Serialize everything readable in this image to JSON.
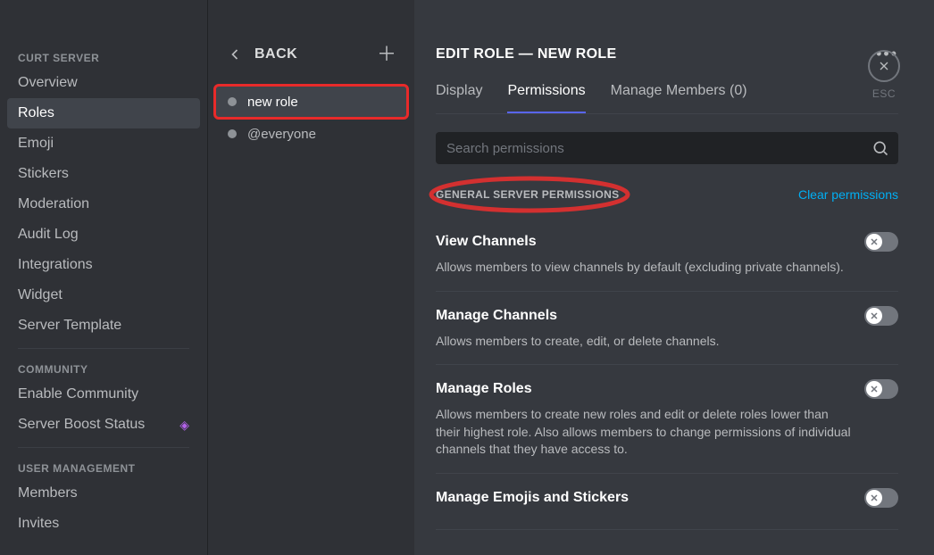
{
  "sidebar": {
    "sections": [
      {
        "heading": "CURT SERVER",
        "items": [
          {
            "label": "Overview",
            "active": false
          },
          {
            "label": "Roles",
            "active": true
          },
          {
            "label": "Emoji",
            "active": false
          },
          {
            "label": "Stickers",
            "active": false
          },
          {
            "label": "Moderation",
            "active": false
          },
          {
            "label": "Audit Log",
            "active": false
          },
          {
            "label": "Integrations",
            "active": false
          },
          {
            "label": "Widget",
            "active": false
          },
          {
            "label": "Server Template",
            "active": false
          }
        ]
      },
      {
        "heading": "COMMUNITY",
        "items": [
          {
            "label": "Enable Community",
            "active": false
          },
          {
            "label": "Server Boost Status",
            "active": false,
            "boost_icon": true
          }
        ]
      },
      {
        "heading": "USER MANAGEMENT",
        "items": [
          {
            "label": "Members",
            "active": false
          },
          {
            "label": "Invites",
            "active": false
          }
        ]
      }
    ]
  },
  "roles_col": {
    "back_label": "BACK",
    "roles": [
      {
        "name": "new role",
        "selected": true,
        "highlight": true
      },
      {
        "name": "@everyone",
        "selected": false
      }
    ]
  },
  "main": {
    "title": "EDIT ROLE — NEW ROLE",
    "tabs": [
      {
        "label": "Display",
        "active": false
      },
      {
        "label": "Permissions",
        "active": true
      },
      {
        "label": "Manage Members (0)",
        "active": false
      }
    ],
    "search_placeholder": "Search permissions",
    "group_heading": "GENERAL SERVER PERMISSIONS",
    "clear_label": "Clear permissions",
    "permissions": [
      {
        "title": "View Channels",
        "desc": "Allows members to view channels by default (excluding private channels).",
        "enabled": false
      },
      {
        "title": "Manage Channels",
        "desc": "Allows members to create, edit, or delete channels.",
        "enabled": false
      },
      {
        "title": "Manage Roles",
        "desc": "Allows members to create new roles and edit or delete roles lower than their highest role. Also allows members to change permissions of individual channels that they have access to.",
        "enabled": false
      },
      {
        "title": "Manage Emojis and Stickers",
        "desc": "",
        "enabled": false
      }
    ]
  },
  "close": {
    "label": "ESC"
  },
  "colors": {
    "annotation_red": "#d33030",
    "link_blue": "#00aff4"
  }
}
